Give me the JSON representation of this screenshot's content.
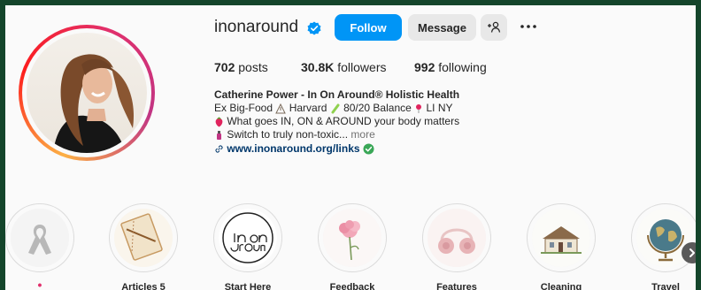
{
  "profile": {
    "username": "inonaround",
    "follow_label": "Follow",
    "message_label": "Message",
    "add_friend_icon": "person-add-icon",
    "more_icon": "ellipsis-icon"
  },
  "stats": {
    "posts_value": "702",
    "posts_label": " posts",
    "followers_value": "30.8K",
    "followers_label": " followers",
    "following_value": "992",
    "following_label": " following"
  },
  "bio": {
    "name": "Catherine Power - In On Around® Holistic Health",
    "line1": "Ex Big-Food ⚠️ Harvard 🧪 80/20 Balance 📍 LI NY",
    "line1_parts": [
      "Ex Big-Food ",
      " Harvard ",
      " 80/20 Balance ",
      " LI NY"
    ],
    "line2": " What goes IN, ON & AROUND your body matters",
    "line3": " Switch to truly non-toxic...",
    "more": " more",
    "link": "www.inonaround.org/links"
  },
  "highlights": [
    {
      "label": "•"
    },
    {
      "label": "Articles 5"
    },
    {
      "label": "Start Here"
    },
    {
      "label": "Feedback"
    },
    {
      "label": "Features"
    },
    {
      "label": "Cleaning"
    },
    {
      "label": "Travel"
    }
  ],
  "colors": {
    "accent": "#0095f6",
    "verified": "#0095f6",
    "ring_start": "#fcb045",
    "ring_end": "#c13584"
  }
}
